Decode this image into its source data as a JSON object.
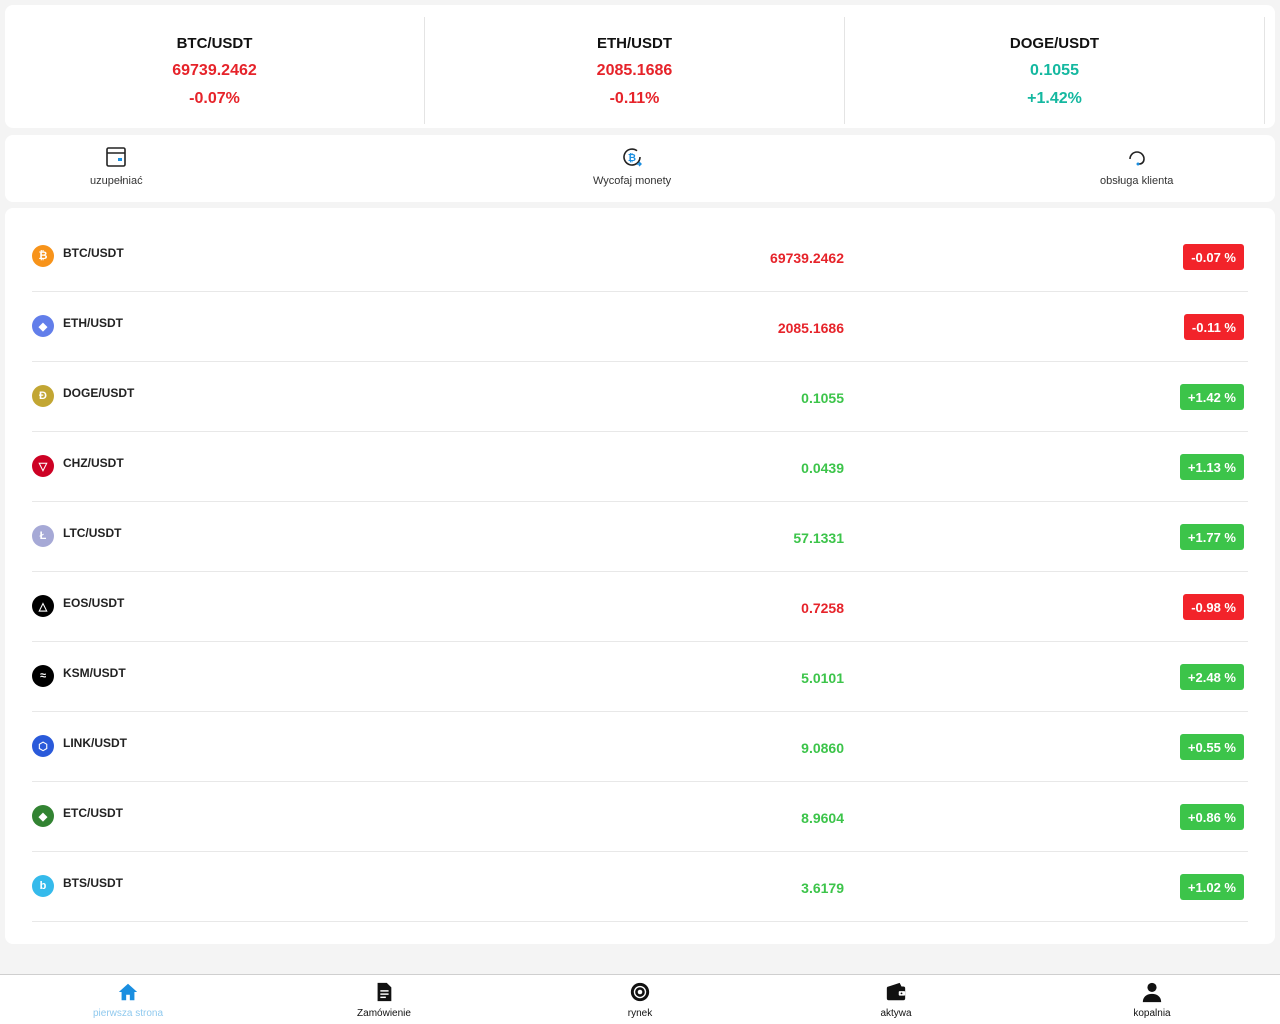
{
  "tickers": [
    {
      "pair": "BTC/USDT",
      "price": "69739.2462",
      "change": "-0.07%",
      "color": "#e6232a"
    },
    {
      "pair": "ETH/USDT",
      "price": "2085.1686",
      "change": "-0.11%",
      "color": "#e6232a"
    },
    {
      "pair": "DOGE/USDT",
      "price": "0.1055",
      "change": "+1.42%",
      "color": "#14b8a0"
    }
  ],
  "actions": {
    "deposit_label": "uzupełniać",
    "withdraw_label": "Wycofaj monety",
    "support_label": "obsługa klienta"
  },
  "market": [
    {
      "pair": "BTC/USDT",
      "price": "69739.2462",
      "change": "-0.07 %",
      "trend": "down",
      "icon": "btc-icon",
      "icon_color": "#f7931a",
      "glyph": "₿"
    },
    {
      "pair": "ETH/USDT",
      "price": "2085.1686",
      "change": "-0.11 %",
      "trend": "down",
      "icon": "eth-icon",
      "icon_color": "#627eea",
      "glyph": "◆"
    },
    {
      "pair": "DOGE/USDT",
      "price": "0.1055",
      "change": "+1.42 %",
      "trend": "up",
      "icon": "doge-icon",
      "icon_color": "#c2a633",
      "glyph": "Ð"
    },
    {
      "pair": "CHZ/USDT",
      "price": "0.0439",
      "change": "+1.13 %",
      "trend": "up",
      "icon": "chz-icon",
      "icon_color": "#cd0124",
      "glyph": "▽"
    },
    {
      "pair": "LTC/USDT",
      "price": "57.1331",
      "change": "+1.77 %",
      "trend": "up",
      "icon": "ltc-icon",
      "icon_color": "#a6a9d6",
      "glyph": "Ł"
    },
    {
      "pair": "EOS/USDT",
      "price": "0.7258",
      "change": "-0.98 %",
      "trend": "down",
      "icon": "eos-icon",
      "icon_color": "#000000",
      "glyph": "△"
    },
    {
      "pair": "KSM/USDT",
      "price": "5.0101",
      "change": "+2.48 %",
      "trend": "up",
      "icon": "ksm-icon",
      "icon_color": "#000000",
      "glyph": "≈"
    },
    {
      "pair": "LINK/USDT",
      "price": "9.0860",
      "change": "+0.55 %",
      "trend": "up",
      "icon": "link-icon",
      "icon_color": "#2a5ada",
      "glyph": "⬡"
    },
    {
      "pair": "ETC/USDT",
      "price": "8.9604",
      "change": "+0.86 %",
      "trend": "up",
      "icon": "etc-icon",
      "icon_color": "#328332",
      "glyph": "◆"
    },
    {
      "pair": "BTS/USDT",
      "price": "3.6179",
      "change": "+1.02 %",
      "trend": "up",
      "icon": "bts-icon",
      "icon_color": "#35baeb",
      "glyph": "b"
    }
  ],
  "nav": {
    "home_label": "pierwsza strona",
    "orders_label": "Zamówienie",
    "market_label": "rynek",
    "assets_label": "aktywa",
    "mining_label": "kopalnia"
  },
  "colors": {
    "up": "#3cc44a",
    "down": "#f2232a",
    "accent": "#1a8ee0"
  }
}
